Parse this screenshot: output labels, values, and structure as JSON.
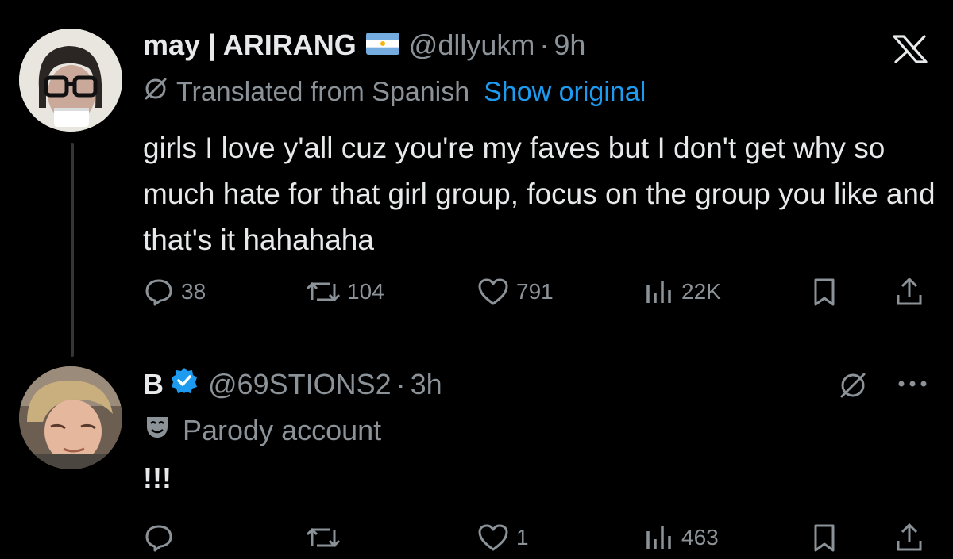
{
  "tweet": {
    "display_name": "may | ARIRANG",
    "flag_icon": "argentina-flag-icon",
    "handle": "@dllyukm",
    "separator": "·",
    "time": "9h",
    "translated_label": "Translated from Spanish",
    "show_original_label": "Show original",
    "text": "girls I love y'all cuz you're my faves but I don't get why so much hate for that girl group, focus on the group you like and that's it hahahaha",
    "replies": "38",
    "reposts": "104",
    "likes": "791",
    "views": "22K"
  },
  "reply": {
    "display_name": "B",
    "verified_icon": "verified-badge-icon",
    "handle": "@69STIONS2",
    "separator": "·",
    "time": "3h",
    "parody_label": "Parody account",
    "text": "!!!",
    "replies": "",
    "reposts": "",
    "likes": "1",
    "views": "463"
  },
  "colors": {
    "background": "#000000",
    "text": "#e7e9ea",
    "muted": "#8b9298",
    "link": "#1d9bf0",
    "verified": "#1d9bf0"
  }
}
